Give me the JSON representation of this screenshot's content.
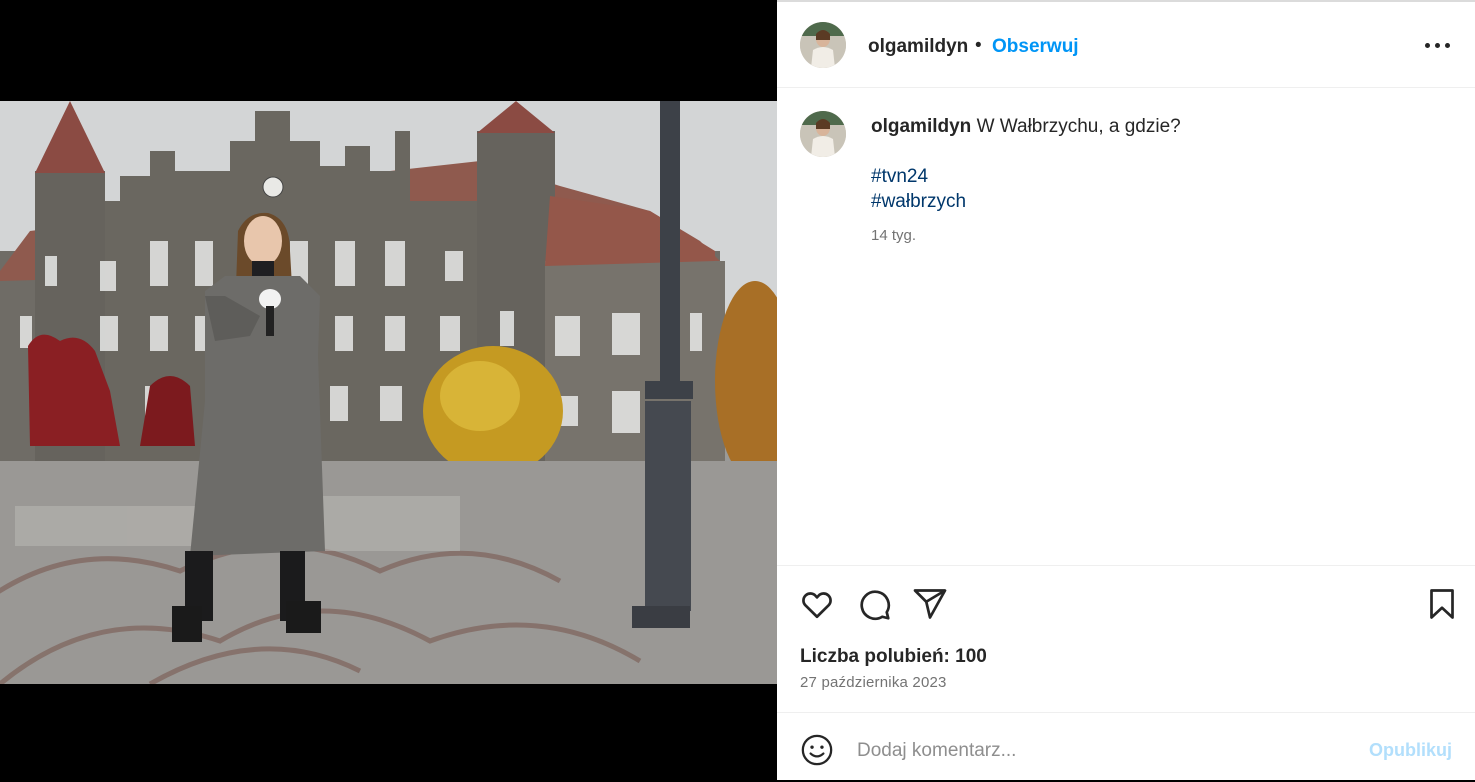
{
  "post": {
    "username": "olgamildyn",
    "follow_label": "Obserwuj",
    "separator": "•",
    "more_icon": "more-horizontal-icon",
    "caption_text": "W Wałbrzychu, a gdzie?",
    "hashtags": [
      "#tvn24",
      "#wałbrzych"
    ],
    "caption_time": "14 tyg.",
    "likes_text": "Liczba polubień: 100",
    "date": "27 października 2023"
  },
  "actions": {
    "like_icon": "heart-icon",
    "comment_icon": "comment-icon",
    "share_icon": "share-icon",
    "save_icon": "bookmark-icon"
  },
  "comment": {
    "placeholder": "Dodaj komentarz...",
    "publish_label": "Opublikuj",
    "emoji_icon": "emoji-icon"
  },
  "colors": {
    "link_blue": "#0095f6",
    "hashtag": "#00376b",
    "publish_disabled": "#b2dffc",
    "muted_text": "#737373"
  }
}
